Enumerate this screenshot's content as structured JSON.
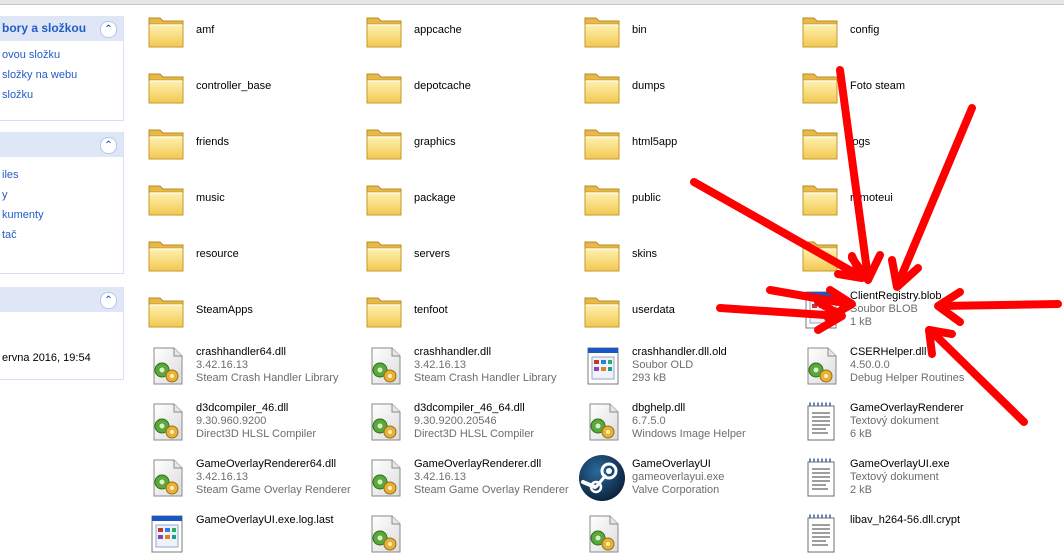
{
  "panels": [
    {
      "title": "bory a složkou",
      "chevron": "double-chevron-up-icon",
      "items": [
        "ovou složku",
        "složky na webu",
        "složku"
      ]
    },
    {
      "title": "",
      "chevron": "double-chevron-up-icon",
      "items": [
        "iles",
        "y",
        "kumenty",
        "tač"
      ]
    },
    {
      "title": "",
      "chevron": "double-chevron-up-icon",
      "detail": "ervna 2016, 19:54"
    }
  ],
  "folders": [
    "amf",
    "appcache",
    "bin",
    "config",
    "controller_base",
    "depotcache",
    "dumps",
    "Foto steam",
    "friends",
    "graphics",
    "html5app",
    "logs",
    "music",
    "package",
    "public",
    "remoteui",
    "resource",
    "servers",
    "skins",
    "",
    "SteamApps",
    "tenfoot",
    "userdata"
  ],
  "files": [
    {
      "name": "ClientRegistry.blob",
      "type": "Soubor BLOB",
      "size": "1 kB",
      "icon": "generic-file-icon"
    },
    {
      "name": "crashhandler64.dll",
      "type": "3.42.16.13",
      "size": "Steam Crash Handler Library",
      "icon": "dll-icon"
    },
    {
      "name": "crashhandler.dll",
      "type": "3.42.16.13",
      "size": "Steam Crash Handler Library",
      "icon": "dll-icon"
    },
    {
      "name": "crashhandler.dll.old",
      "type": "Soubor OLD",
      "size": "293 kB",
      "icon": "generic-file-icon"
    },
    {
      "name": "CSERHelper.dll",
      "type": "4.50.0.0",
      "size": "Debug Helper Routines",
      "icon": "dll-icon"
    },
    {
      "name": "d3dcompiler_46.dll",
      "type": "9.30.960.9200",
      "size": "Direct3D HLSL Compiler",
      "icon": "dll-icon"
    },
    {
      "name": "d3dcompiler_46_64.dll",
      "type": "9.30.9200.20546",
      "size": "Direct3D HLSL Compiler",
      "icon": "dll-icon"
    },
    {
      "name": "dbghelp.dll",
      "type": "6.7.5.0",
      "size": "Windows Image Helper",
      "icon": "dll-icon"
    },
    {
      "name": "GameOverlayRenderer",
      "type": "Textový dokument",
      "size": "6 kB",
      "icon": "text-document-icon"
    },
    {
      "name": "GameOverlayRenderer64.dll",
      "type": "3.42.16.13",
      "size": "Steam Game Overlay Renderer",
      "icon": "dll-icon"
    },
    {
      "name": "GameOverlayRenderer.dll",
      "type": "3.42.16.13",
      "size": "Steam Game Overlay Renderer",
      "icon": "dll-icon"
    },
    {
      "name": "GameOverlayUI",
      "type": "gameoverlayui.exe",
      "size": "Valve Corporation",
      "icon": "steam-logo-icon"
    },
    {
      "name": "GameOverlayUI.exe",
      "type": "Textový dokument",
      "size": "2 kB",
      "icon": "text-document-icon"
    },
    {
      "name": "GameOverlayUI.exe.log.last",
      "type": "",
      "size": "",
      "icon": "generic-file-icon"
    },
    {
      "name": "",
      "type": "",
      "size": "",
      "icon": "dll-icon"
    },
    {
      "name": "",
      "type": "",
      "size": "",
      "icon": "dll-icon"
    },
    {
      "name": "libav_h264-56.dll.crypt",
      "type": "",
      "size": "",
      "icon": "text-document-icon"
    }
  ],
  "annotation": {
    "color": "#ff0000",
    "target": "ClientRegistry.blob"
  }
}
